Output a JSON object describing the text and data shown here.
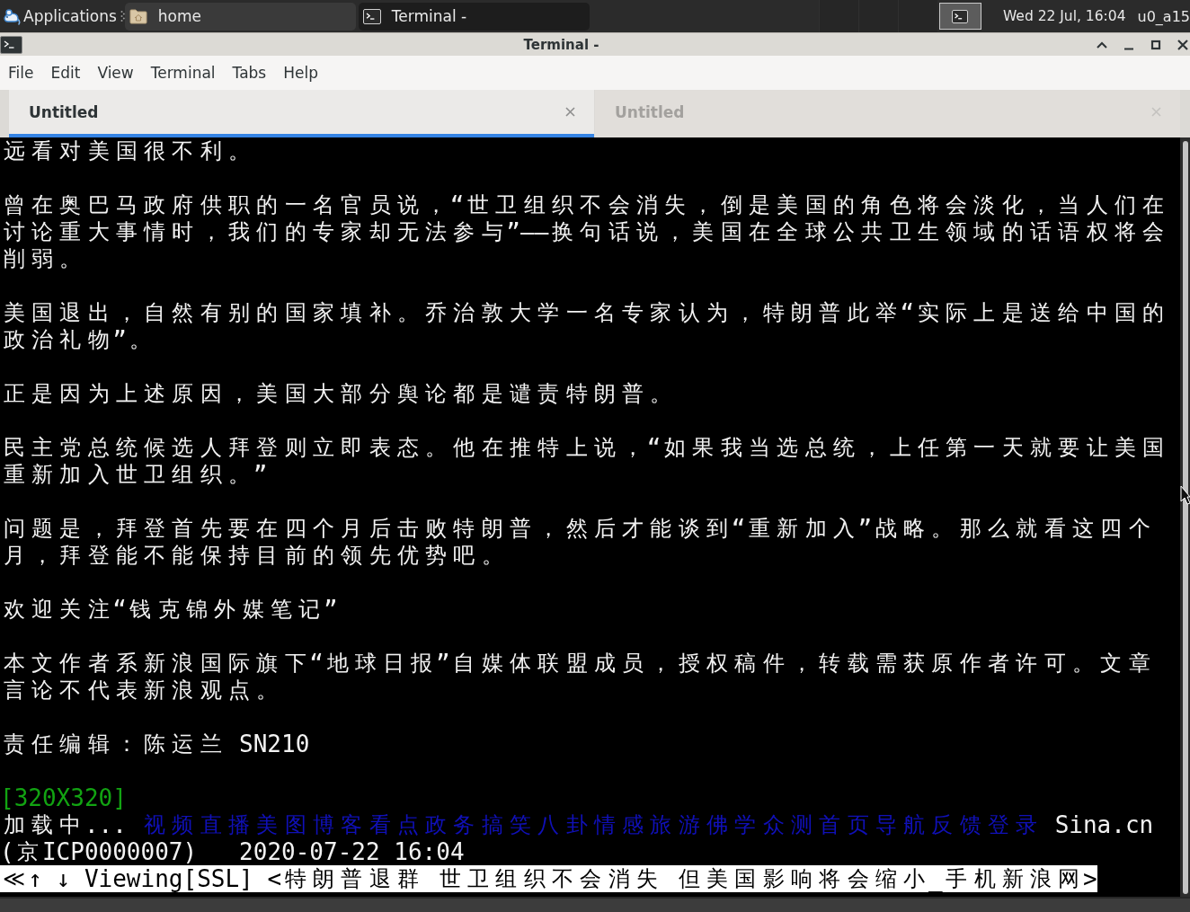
{
  "panel": {
    "applications_label": "Applications",
    "tasks": [
      {
        "label": "home",
        "kind": "folder",
        "selected": false
      },
      {
        "label": "Terminal -",
        "kind": "terminal",
        "selected": true
      }
    ],
    "workspaces": [
      {
        "selected": false,
        "has_window": false
      },
      {
        "selected": false,
        "has_window": false
      },
      {
        "selected": false,
        "has_window": false
      },
      {
        "selected": true,
        "has_window": true
      }
    ],
    "clock": "Wed 22 Jul, 16:04",
    "user": "u0_a15"
  },
  "window": {
    "title": "Terminal -"
  },
  "menu": [
    {
      "label": "File"
    },
    {
      "label": "Edit"
    },
    {
      "label": "View"
    },
    {
      "label": "Terminal"
    },
    {
      "label": "Tabs"
    },
    {
      "label": "Help"
    }
  ],
  "tabs": [
    {
      "label": "Untitled",
      "selected": true
    },
    {
      "label": "Untitled",
      "selected": false
    }
  ],
  "terminal": {
    "rows": [
      {
        "kind": "text",
        "text": "远看对美国很不利。"
      },
      {
        "kind": "blank"
      },
      {
        "kind": "text",
        "text": "曾在奥巴马政府供职的一名官员说，“世卫组织不会消失，倒是美国的角色将会淡化，当人们在"
      },
      {
        "kind": "text",
        "text": "讨论重大事情时，我们的专家却无法参与”——换句话说，美国在全球公共卫生领域的话语权将会"
      },
      {
        "kind": "text",
        "text": "削弱。"
      },
      {
        "kind": "blank"
      },
      {
        "kind": "text",
        "text": "美国退出，自然有别的国家填补。乔治敦大学一名专家认为，特朗普此举“实际上是送给中国的"
      },
      {
        "kind": "text",
        "text": "政治礼物”。"
      },
      {
        "kind": "blank"
      },
      {
        "kind": "text",
        "text": "正是因为上述原因，美国大部分舆论都是谴责特朗普。"
      },
      {
        "kind": "blank"
      },
      {
        "kind": "text",
        "text": "民主党总统候选人拜登则立即表态。他在推特上说，“如果我当选总统，上任第一天就要让美国"
      },
      {
        "kind": "text",
        "text": "重新加入世卫组织。”"
      },
      {
        "kind": "blank"
      },
      {
        "kind": "text",
        "text": "问题是，拜登首先要在四个月后击败特朗普，然后才能谈到“重新加入”战略。那么就看这四个"
      },
      {
        "kind": "text",
        "text": "月，拜登能不能保持目前的领先优势吧。"
      },
      {
        "kind": "blank"
      },
      {
        "kind": "text",
        "text": "欢迎关注“钱克锦外媒笔记”"
      },
      {
        "kind": "blank"
      },
      {
        "kind": "text",
        "text": "本文作者系新浪国际旗下“地球日报”自媒体联盟成员，授权稿件，转载需获原作者许可。文章"
      },
      {
        "kind": "text",
        "text": "言论不代表新浪观点。"
      },
      {
        "kind": "blank"
      },
      {
        "kind": "text",
        "text": "责任编辑：陈运兰 SN210"
      },
      {
        "kind": "blank"
      },
      {
        "kind": "image",
        "text": "[320X320]"
      },
      {
        "kind": "links",
        "prefix": "加载中...",
        "links": [
          "视频",
          "直播",
          "美图",
          "博客",
          "看点",
          "政务",
          "搞笑",
          "八卦",
          "情感",
          "旅游",
          "佛学",
          "众测",
          "首页",
          "导航",
          "反馈",
          "登录"
        ],
        "suffix": "Sina.cn"
      },
      {
        "kind": "text",
        "text": "(京ICP0000007)   2020-07-22 16:04"
      },
      {
        "kind": "status",
        "text": "≪↑ ↓ Viewing[SSL] <特朗普退群 世卫组织不会消失 但美国影响将会缩小_手机新浪网>"
      }
    ]
  }
}
